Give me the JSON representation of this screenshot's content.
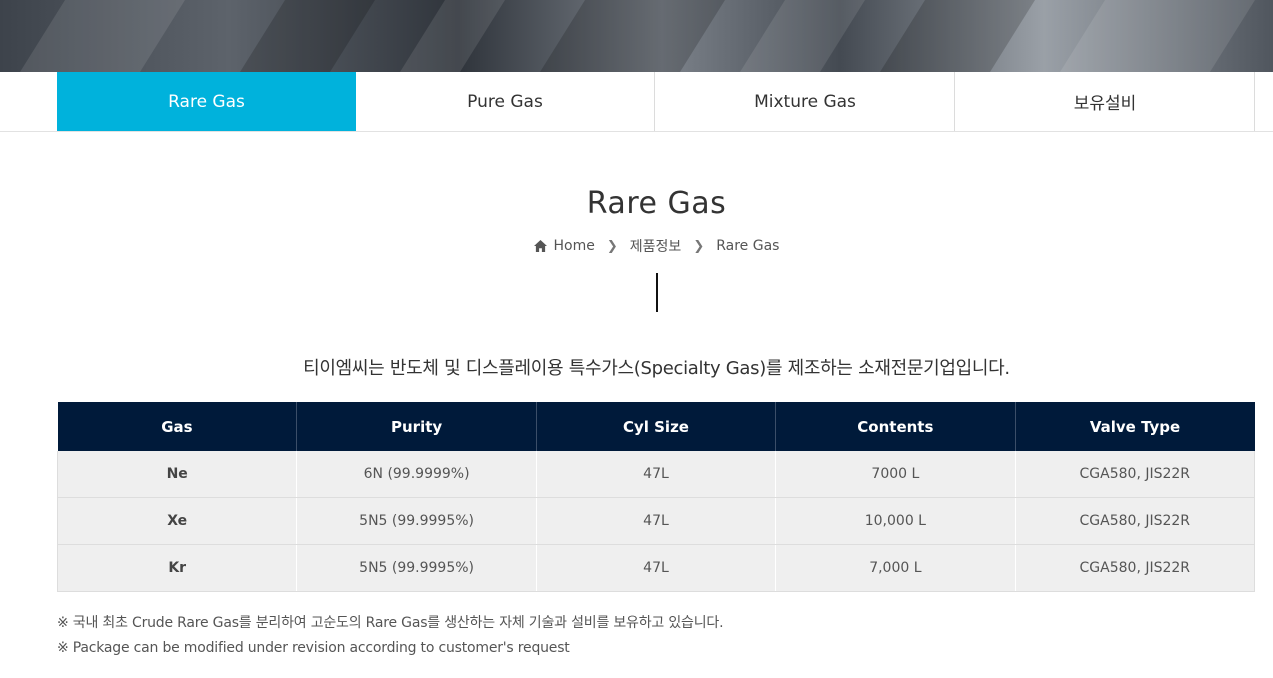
{
  "tabs": [
    {
      "label": "Rare Gas",
      "active": true
    },
    {
      "label": "Pure Gas",
      "active": false
    },
    {
      "label": "Mixture Gas",
      "active": false
    },
    {
      "label": "보유설비",
      "active": false
    }
  ],
  "page": {
    "title": "Rare Gas",
    "intro": "티이엠씨는 반도체 및 디스플레이용 특수가스(Specialty Gas)를 제조하는 소재전문기업입니다."
  },
  "breadcrumb": {
    "icon": "home-icon",
    "home": "Home",
    "category": "제품정보",
    "current": "Rare Gas"
  },
  "table": {
    "headers": [
      "Gas",
      "Purity",
      "Cyl Size",
      "Contents",
      "Valve Type"
    ],
    "rows": [
      [
        "Ne",
        "6N (99.9999%)",
        "47L",
        "7000 L",
        "CGA580, JIS22R"
      ],
      [
        "Xe",
        "5N5 (99.9995%)",
        "47L",
        "10,000 L",
        "CGA580, JIS22R"
      ],
      [
        "Kr",
        "5N5 (99.9995%)",
        "47L",
        "7,000 L",
        "CGA580, JIS22R"
      ]
    ]
  },
  "notes": [
    "※ 국내 최초 Crude Rare Gas를 분리하여 고순도의 Rare Gas를 생산하는 자체 기술과 설비를 보유하고 있습니다.",
    "※ Package can be modified under revision according to customer's request"
  ],
  "colors": {
    "accent": "#00b2dc",
    "table_header": "#001a3a"
  }
}
